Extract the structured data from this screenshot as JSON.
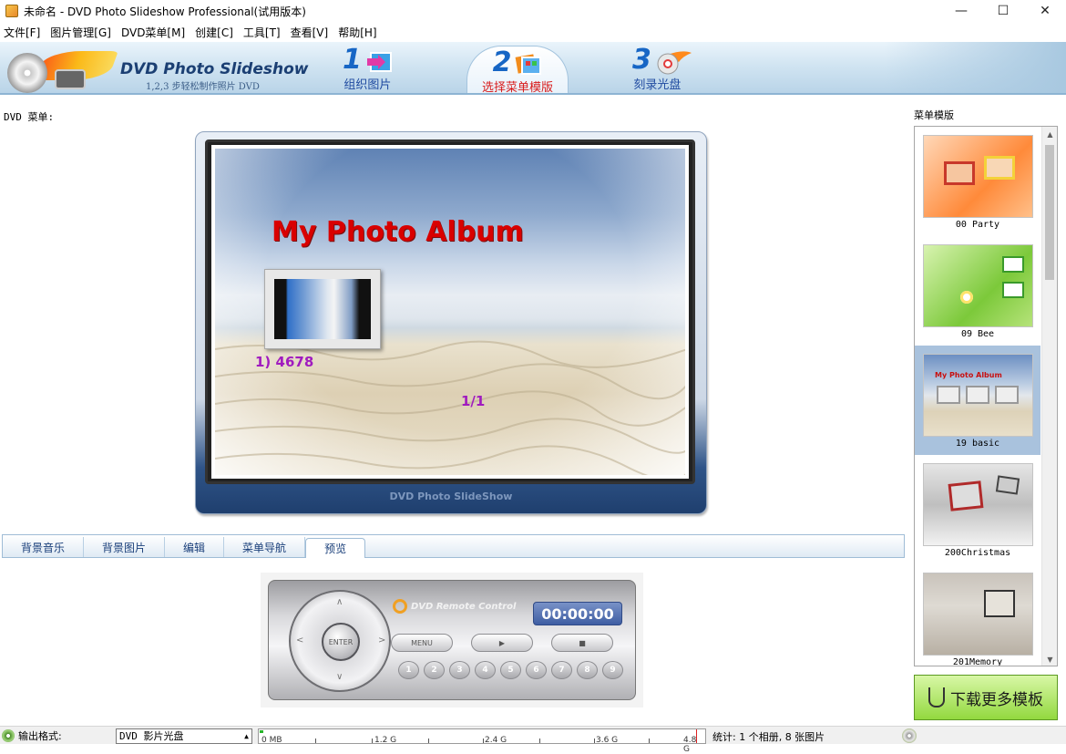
{
  "window": {
    "title": "未命名 - DVD Photo Slideshow Professional(试用版本)"
  },
  "menu": [
    "文件[F]",
    "图片管理[G]",
    "DVD菜单[M]",
    "创建[C]",
    "工具[T]",
    "查看[V]",
    "帮助[H]"
  ],
  "banner": {
    "brand": "DVD Photo Slideshow",
    "brand_sub": "1,2,3 步轻松制作照片 DVD",
    "steps": [
      {
        "num": "1",
        "label": "组织图片"
      },
      {
        "num": "2",
        "label": "选择菜单模版"
      },
      {
        "num": "3",
        "label": "刻录光盘"
      }
    ]
  },
  "main": {
    "dvd_menu_label": "DVD 菜单:",
    "preview": {
      "album_title": "My Photo Album",
      "item_label": "1)   4678",
      "page_label": "1/1",
      "caption": "DVD Photo SlideShow"
    },
    "tabs": [
      "背景音乐",
      "背景图片",
      "编辑",
      "菜单导航",
      "预览"
    ],
    "remote": {
      "brand": "DVD Remote Control",
      "timer": "00:00:00",
      "enter": "ENTER",
      "menu_btn": "MENU",
      "play_btn": "▶",
      "stop_btn": "■",
      "numbers": [
        "1",
        "2",
        "3",
        "4",
        "5",
        "6",
        "7",
        "8",
        "9"
      ]
    }
  },
  "templates": {
    "label": "菜单模版",
    "items": [
      {
        "name": "00 Party",
        "selected": false
      },
      {
        "name": "09 Bee",
        "selected": false
      },
      {
        "name": "19 basic",
        "selected": true
      },
      {
        "name": "200Christmas",
        "selected": false
      },
      {
        "name": "201Memory",
        "selected": false
      }
    ],
    "download": "下载更多模板"
  },
  "status": {
    "format_label": "输出格式:",
    "format_value": "DVD 影片光盘",
    "ruler_marks": [
      "0 MB",
      "1.2 G",
      "2.4 G",
      "3.6 G",
      "4.8 G"
    ],
    "stats": "统计: 1 个相册, 8 张图片"
  }
}
